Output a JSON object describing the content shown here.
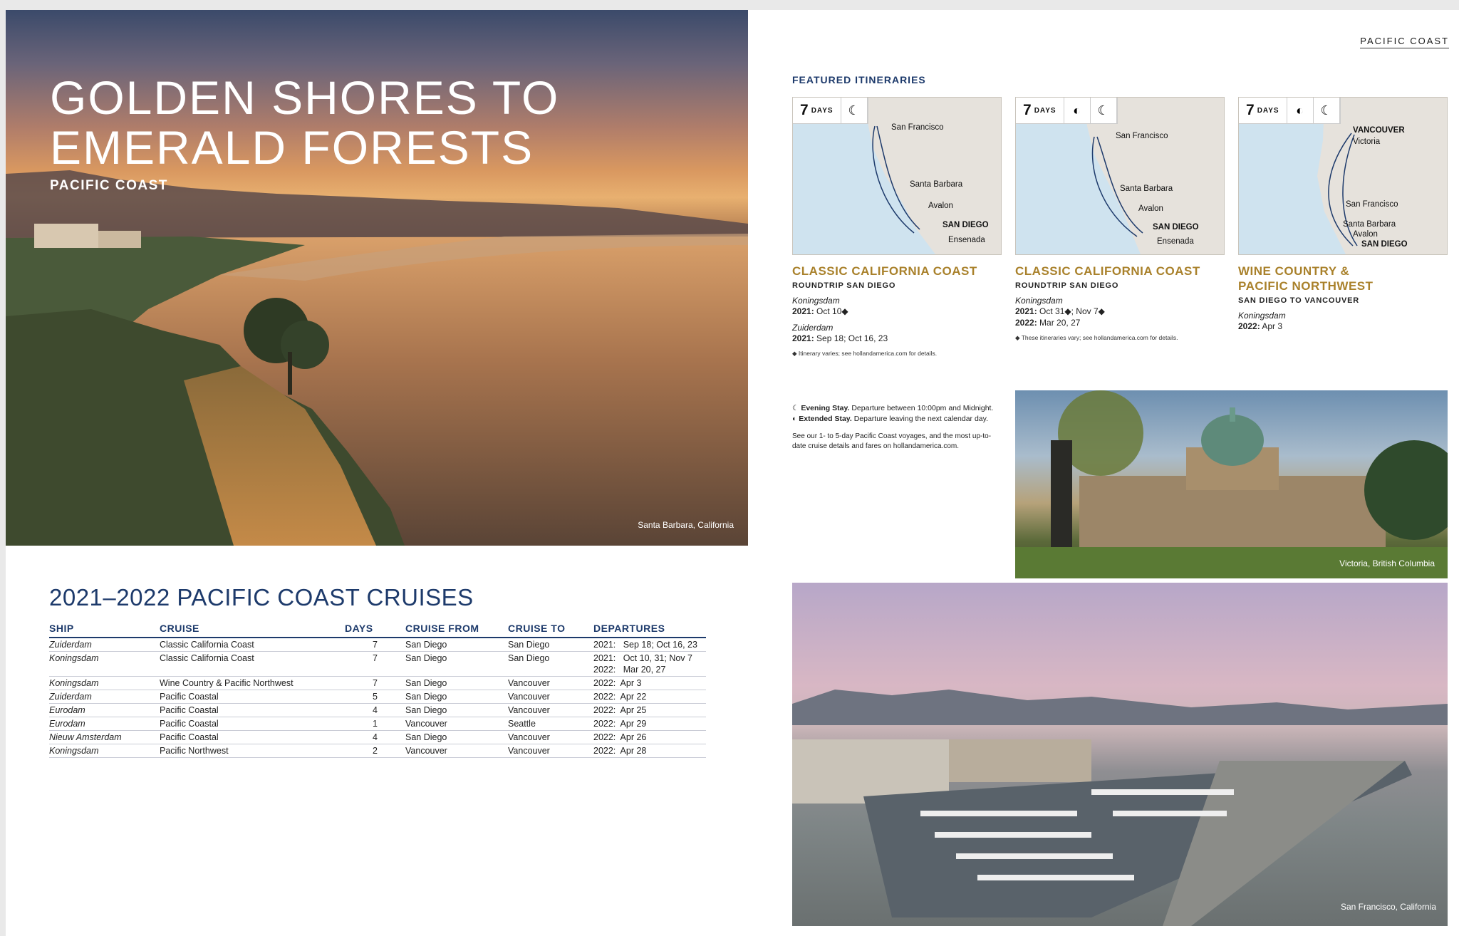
{
  "hero": {
    "title_line1": "GOLDEN SHORES TO",
    "title_line2": "EMERALD FORESTS",
    "subtitle": "PACIFIC COAST",
    "caption": "Santa Barbara, California"
  },
  "section_tag": "PACIFIC COAST",
  "featured_heading": "FEATURED ITINERARIES",
  "itineraries": [
    {
      "days": "7",
      "days_label": "DAYS",
      "ports": [
        "San Francisco",
        "Santa Barbara",
        "Avalon",
        "SAN DIEGO",
        "Ensenada"
      ],
      "title": "CLASSIC CALIFORNIA COAST",
      "route": "ROUNDTRIP SAN DIEGO",
      "ship1": "Koningsdam",
      "ship1_year": "2021:",
      "ship1_dates": "Oct 10◆",
      "ship2": "Zuiderdam",
      "ship2_year": "2021:",
      "ship2_dates": "Sep 18; Oct 16, 23",
      "note": "◆ Itinerary varies; see hollandamerica.com for details."
    },
    {
      "days": "7",
      "days_label": "DAYS",
      "ports": [
        "San Francisco",
        "Santa Barbara",
        "Avalon",
        "SAN DIEGO",
        "Ensenada"
      ],
      "title": "CLASSIC CALIFORNIA COAST",
      "route": "ROUNDTRIP SAN DIEGO",
      "ship1": "Koningsdam",
      "ship1_year": "2021:",
      "ship1_dates": "Oct 31◆; Nov 7◆",
      "ship1_year2": "2022:",
      "ship1_dates2": "Mar 20, 27",
      "note": "◆ These itineraries vary; see hollandamerica.com for details."
    },
    {
      "days": "7",
      "days_label": "DAYS",
      "ports": [
        "VANCOUVER",
        "Victoria",
        "San Francisco",
        "Santa Barbara",
        "Avalon",
        "SAN DIEGO"
      ],
      "title_line1": "WINE COUNTRY &",
      "title_line2": "PACIFIC NORTHWEST",
      "route": "SAN DIEGO TO VANCOUVER",
      "ship1": "Koningsdam",
      "ship1_year": "2022:",
      "ship1_dates": "Apr 3"
    }
  ],
  "legend": {
    "evening_label": "Evening Stay.",
    "evening_text": "Departure between 10:00pm and Midnight.",
    "extended_label": "Extended Stay.",
    "extended_text": "Departure leaving the next calendar day.",
    "note": "See our 1- to 5-day Pacific Coast voyages, and the most up-to-date cruise details and fares on hollandamerica.com."
  },
  "photos": {
    "victoria_caption": "Victoria, British Columbia",
    "sf_caption": "San Francisco, California"
  },
  "table": {
    "title": "2021–2022 PACIFIC COAST CRUISES",
    "headers": [
      "SHIP",
      "CRUISE",
      "DAYS",
      "CRUISE FROM",
      "CRUISE TO",
      "DEPARTURES"
    ],
    "rows": [
      {
        "ship": "Zuiderdam",
        "cruise": "Classic California Coast",
        "days": "7",
        "from": "San Diego",
        "to": "San Diego",
        "dep": "2021:   Sep 18; Oct 16, 23"
      },
      {
        "ship": "Koningsdam",
        "cruise": "Classic California Coast",
        "days": "7",
        "from": "San Diego",
        "to": "San Diego",
        "dep": "2021:   Oct 10, 31; Nov 7",
        "dep2": "2022:   Mar 20, 27"
      },
      {
        "ship": "Koningsdam",
        "cruise": "Wine Country & Pacific Northwest",
        "days": "7",
        "from": "San Diego",
        "to": "Vancouver",
        "dep": "2022:  Apr 3"
      },
      {
        "ship": "Zuiderdam",
        "cruise": "Pacific Coastal",
        "days": "5",
        "from": "San Diego",
        "to": "Vancouver",
        "dep": "2022:  Apr 22"
      },
      {
        "ship": "Eurodam",
        "cruise": "Pacific Coastal",
        "days": "4",
        "from": "San Diego",
        "to": "Vancouver",
        "dep": "2022:  Apr 25"
      },
      {
        "ship": "Eurodam",
        "cruise": "Pacific Coastal",
        "days": "1",
        "from": "Vancouver",
        "to": "Seattle",
        "dep": "2022:  Apr 29"
      },
      {
        "ship": "Nieuw Amsterdam",
        "cruise": "Pacific Coastal",
        "days": "4",
        "from": "San Diego",
        "to": "Vancouver",
        "dep": "2022:  Apr 26"
      },
      {
        "ship": "Koningsdam",
        "cruise": "Pacific Northwest",
        "days": "2",
        "from": "Vancouver",
        "to": "Vancouver",
        "dep": "2022:  Apr 28"
      }
    ]
  }
}
